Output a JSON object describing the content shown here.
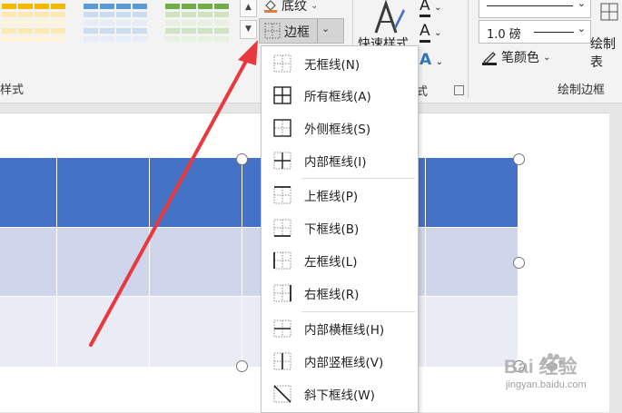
{
  "ribbon": {
    "group_table_styles_label": "样式",
    "shading_label": "底纹",
    "border_label": "边框",
    "quick_styles_label": "快速样式",
    "wordart_dialog_label": "式",
    "pen_weight": "1.0 磅",
    "pen_color_label": "笔颜色",
    "draw_table_label": "绘制表",
    "draw_borders_group_label": "绘制边框"
  },
  "menu": {
    "items": [
      {
        "label": "无框线(N)",
        "icon": "no-border-icon"
      },
      {
        "label": "所有框线(A)",
        "icon": "all-borders-icon"
      },
      {
        "label": "外侧框线(S)",
        "icon": "outside-borders-icon"
      },
      {
        "label": "内部框线(I)",
        "icon": "inside-borders-icon"
      },
      {
        "label": "上框线(P)",
        "icon": "top-border-icon"
      },
      {
        "label": "下框线(B)",
        "icon": "bottom-border-icon"
      },
      {
        "label": "左框线(L)",
        "icon": "left-border-icon"
      },
      {
        "label": "右框线(R)",
        "icon": "right-border-icon"
      },
      {
        "label": "内部横框线(H)",
        "icon": "inside-horizontal-border-icon"
      },
      {
        "label": "内部竖框线(V)",
        "icon": "inside-vertical-border-icon"
      },
      {
        "label": "斜下框线(W)",
        "icon": "diagonal-down-border-icon"
      }
    ]
  },
  "watermark": {
    "brand": "Bai 经验",
    "url": "jingyan.baidu.com"
  },
  "colors": {
    "table_header": "#4472c4",
    "table_band_1": "#cfd5ea",
    "table_band_2": "#e9ebf5",
    "arrow": "#e8393e"
  }
}
